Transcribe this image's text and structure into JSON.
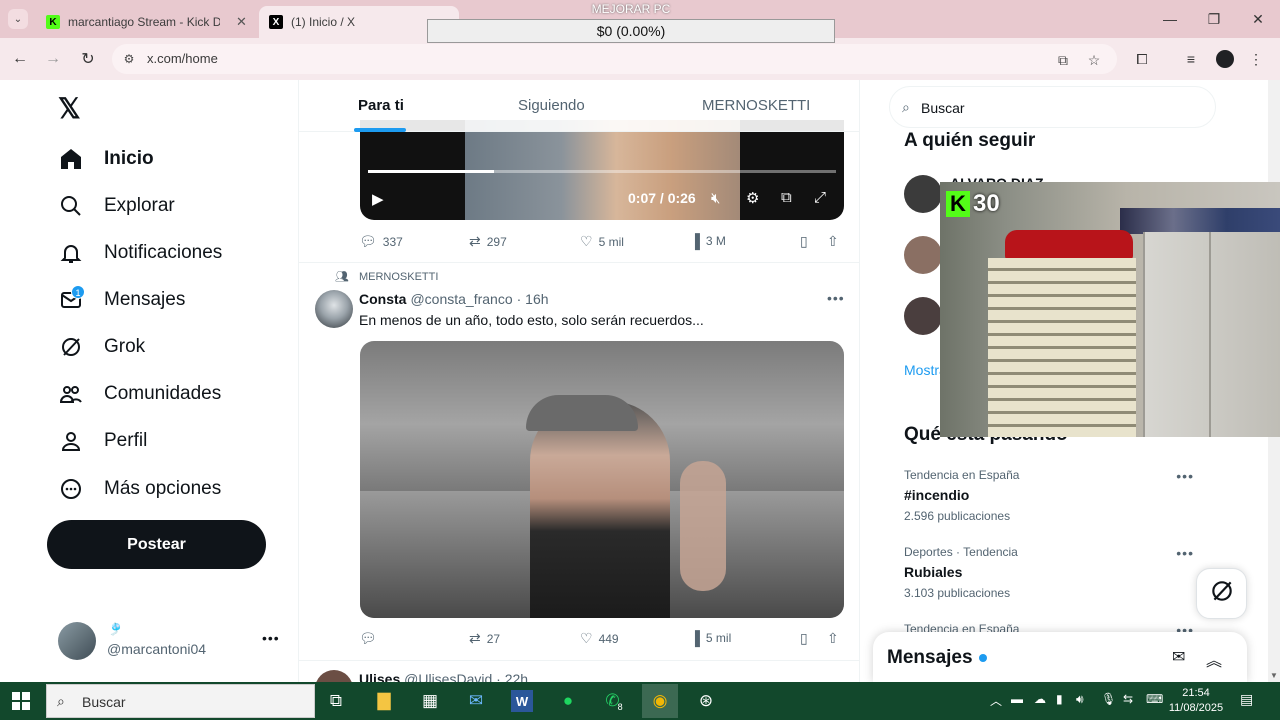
{
  "browser": {
    "tabs": [
      {
        "title": "marcantiago Stream - Kick Das",
        "favicon": "kick-icon",
        "active": false
      },
      {
        "title": "(1) Inicio / X",
        "favicon": "x-icon",
        "active": true
      }
    ],
    "url": "x.com/home"
  },
  "overlay": {
    "title": "MEJORAR PC",
    "value": "$0 (0.00%)"
  },
  "x": {
    "nav": {
      "items": [
        {
          "label": "Inicio",
          "icon": "home-icon",
          "active": true
        },
        {
          "label": "Explorar",
          "icon": "search-icon"
        },
        {
          "label": "Notificaciones",
          "icon": "bell-icon"
        },
        {
          "label": "Mensajes",
          "icon": "mail-icon",
          "badge": "1"
        },
        {
          "label": "Grok",
          "icon": "grok-icon"
        },
        {
          "label": "Comunidades",
          "icon": "communities-icon"
        },
        {
          "label": "Perfil",
          "icon": "person-icon"
        },
        {
          "label": "Más opciones",
          "icon": "more-circle-icon"
        }
      ],
      "post_button": "Postear"
    },
    "account": {
      "emoji": "🎐",
      "handle": "@marcantoni04"
    },
    "home_tabs": [
      "Para ti",
      "Siguiendo",
      "MERNOSKETTI"
    ],
    "video1": {
      "time": "0:07 / 0:26",
      "progress": 0.27
    },
    "tweet1_actions": {
      "replies": "337",
      "reposts": "297",
      "likes": "5 mil",
      "views": "3 M"
    },
    "tweet2": {
      "community": "MERNOSKETTI",
      "name": "Consta",
      "handle": "@consta_franco",
      "time": "· 16h",
      "text": "En menos de un año, todo esto, solo serán recuerdos...",
      "actions": {
        "reposts": "27",
        "likes": "449",
        "views": "5 mil"
      }
    },
    "tweet3": {
      "name": "Ulises",
      "handle": "@UlisesDavid",
      "time": "· 22h"
    },
    "right": {
      "search_placeholder": "Buscar",
      "who_to_follow": "A quién seguir",
      "follow_first_name": "ALVARO DIAZ",
      "show_more": "Mostrar más",
      "trends_title": "Qué está pasando",
      "trends": [
        {
          "context": "Tendencia en España",
          "name": "#incendio",
          "posts": "2.596 publicaciones"
        },
        {
          "context": "Deportes · Tendencia",
          "name": "Rubiales",
          "posts": "3.103 publicaciones"
        },
        {
          "context": "Tendencia en España",
          "name": "",
          "posts": ""
        }
      ]
    },
    "messages_drawer": "Mensajes"
  },
  "stream_cam": {
    "kick_count": "30"
  },
  "taskbar": {
    "search_label": "Buscar",
    "whatsapp_badge": "8",
    "time": "21:54",
    "date": "11/08/2025"
  },
  "colors": {
    "accent": "#1d9bf0",
    "kick_green": "#53fc18",
    "taskbar": "#12482c",
    "tabbar": "#e8c9cf"
  }
}
